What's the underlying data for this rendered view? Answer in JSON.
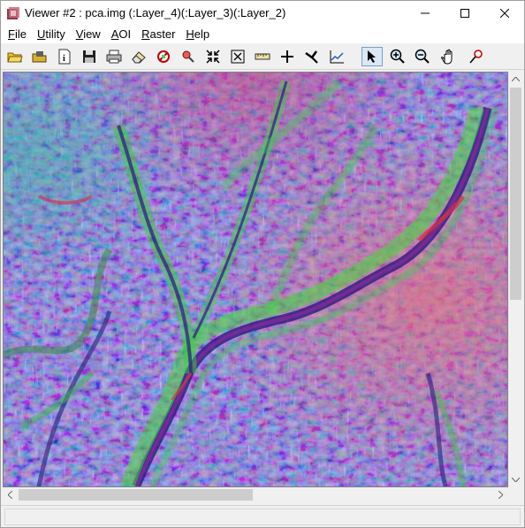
{
  "window": {
    "title": "Viewer #2 : pca.img (:Layer_4)(:Layer_3)(:Layer_2)"
  },
  "menu": [
    {
      "label": "File",
      "accel": "F",
      "rest": "ile"
    },
    {
      "label": "Utility",
      "accel": "U",
      "rest": "tility"
    },
    {
      "label": "View",
      "accel": "V",
      "rest": "iew"
    },
    {
      "label": "AOI",
      "accel": "A",
      "rest": "OI"
    },
    {
      "label": "Raster",
      "accel": "R",
      "rest": "aster"
    },
    {
      "label": "Help",
      "accel": "H",
      "rest": "elp"
    }
  ],
  "toolbar": {
    "tools": [
      "open-folder-icon",
      "open-layer-icon",
      "info-icon",
      "save-icon",
      "print-icon",
      "eraser-icon",
      "clear-view-icon",
      "zoom-region-icon",
      "fit-image-icon",
      "full-extent-icon",
      "measure-icon",
      "inquire-cursor-icon",
      "arrange-icon",
      "profile-icon",
      "select-arrow-icon",
      "zoom-in-icon",
      "zoom-out-icon",
      "pan-hand-icon",
      "rotate-icon"
    ],
    "active_tool": "select-arrow-icon"
  },
  "colors": {
    "image_base": "#6f6cd8",
    "ridge_green": "#3edc3a",
    "valley_purple": "#3a1f8f",
    "accent_red": "#e0566a"
  }
}
